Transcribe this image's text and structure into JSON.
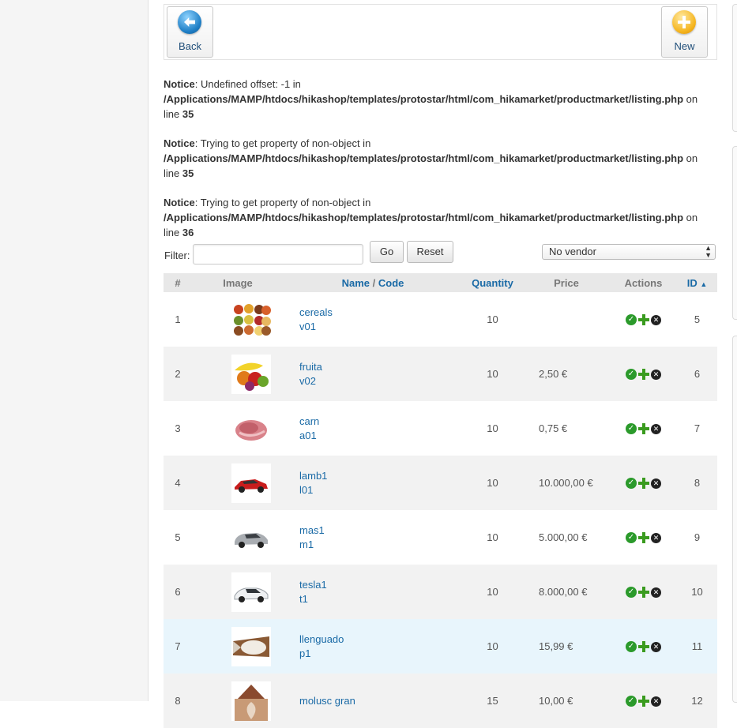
{
  "toolbar": {
    "back_label": "Back",
    "new_label": "New"
  },
  "notices": [
    {
      "label": "Notice",
      "message": ": Undefined offset: -1 in",
      "path": "/Applications/MAMP/htdocs/hikashop/templates/protostar/html/com_hikamarket/productmarket/listing.php",
      "on": " on",
      "line_text": "line ",
      "line": "35"
    },
    {
      "label": "Notice",
      "message": ": Trying to get property of non-object in",
      "path": "/Applications/MAMP/htdocs/hikashop/templates/protostar/html/com_hikamarket/productmarket/listing.php",
      "on": " on",
      "line_text": "line ",
      "line": "35"
    },
    {
      "label": "Notice",
      "message": ": Trying to get property of non-object in",
      "path": "/Applications/MAMP/htdocs/hikashop/templates/protostar/html/com_hikamarket/productmarket/listing.php",
      "on": " on",
      "line_text": "line ",
      "line": "36"
    }
  ],
  "filter": {
    "label": "Filter:",
    "value": "",
    "go": "Go",
    "reset": "Reset",
    "vendor": "No vendor"
  },
  "table": {
    "headers": {
      "num": "#",
      "image": "Image",
      "name": "Name",
      "sep": " / ",
      "code": "Code",
      "quantity": "Quantity",
      "price": "Price",
      "actions": "Actions",
      "id": "ID"
    },
    "rows": [
      {
        "n": "1",
        "name": "cereals",
        "code": "v01",
        "qty": "10",
        "price": "",
        "id": "5",
        "img": "cereals"
      },
      {
        "n": "2",
        "name": "fruita",
        "code": "v02",
        "qty": "10",
        "price": "2,50 €",
        "id": "6",
        "img": "fruit"
      },
      {
        "n": "3",
        "name": "carn",
        "code": "a01",
        "qty": "10",
        "price": "0,75 €",
        "id": "7",
        "img": "meat"
      },
      {
        "n": "4",
        "name": "lamb1",
        "code": "l01",
        "qty": "10",
        "price": "10.000,00 €",
        "id": "8",
        "img": "red-car"
      },
      {
        "n": "5",
        "name": "mas1",
        "code": "m1",
        "qty": "10",
        "price": "5.000,00 €",
        "id": "9",
        "img": "silver-car"
      },
      {
        "n": "6",
        "name": "tesla1",
        "code": "t1",
        "qty": "10",
        "price": "8.000,00 €",
        "id": "10",
        "img": "white-car"
      },
      {
        "n": "7",
        "name": "llenguado",
        "code": "p1",
        "qty": "10",
        "price": "15,99 €",
        "id": "11",
        "img": "fish"
      },
      {
        "n": "8",
        "name": "molusc gran",
        "code": "",
        "qty": "15",
        "price": "10,00 €",
        "id": "12",
        "img": "shell"
      }
    ]
  }
}
